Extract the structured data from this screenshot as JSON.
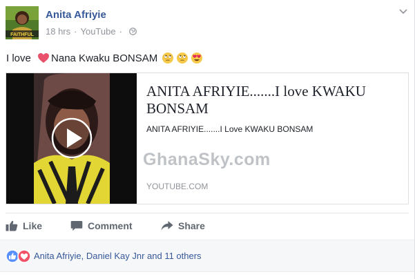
{
  "post": {
    "author": "Anita Afriyie",
    "timestamp": "18 hrs",
    "separator": "·",
    "source": "YouTube",
    "text_before_heart": "I love ",
    "text_after_heart": "Nana Kwaku BONSAM",
    "avatar_caption": "FAITHFUL",
    "privacy_icon": "globe-icon",
    "menu_icon": "chevron-down-icon"
  },
  "link_preview": {
    "title": "ANITA AFRIYIE.......I love KWAKU BONSAM",
    "description": "ANITA AFRIYIE.......I Love KWAKU BONSAM",
    "watermark": "GhanaSky.com",
    "domain": "YOUTUBE.COM"
  },
  "actions": {
    "like": "Like",
    "comment": "Comment",
    "share": "Share"
  },
  "reactions": {
    "summary": "Anita Afriyie, Daniel Kay Jnr and 11 others",
    "icons": [
      "like-reaction-icon",
      "love-reaction-icon"
    ]
  },
  "colors": {
    "link_blue": "#365899",
    "meta_gray": "#90949c",
    "action_gray": "#606770",
    "like_blue": "#5890ff",
    "love_red": "#f25268"
  }
}
